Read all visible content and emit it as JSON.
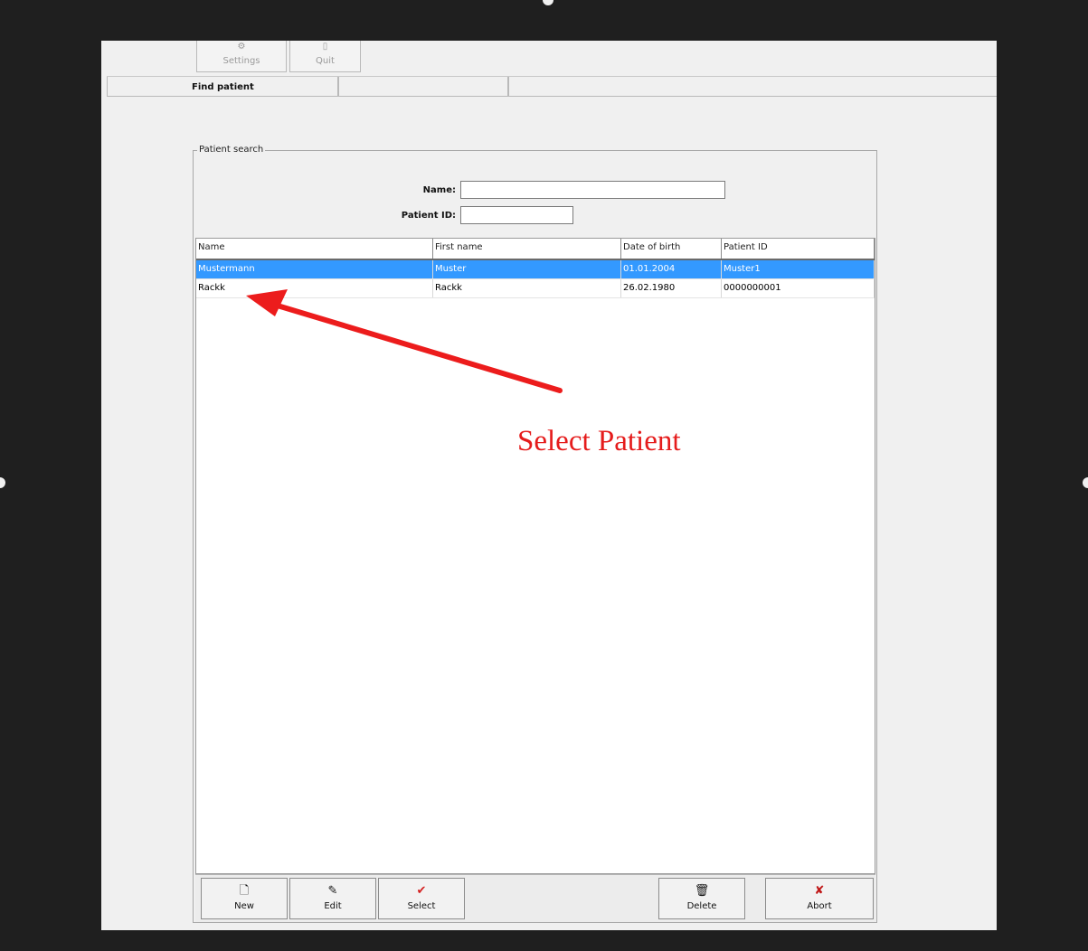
{
  "toolbar": {
    "settings_label": "Settings",
    "quit_label": "Quit"
  },
  "tabs": [
    {
      "label": "Find patient"
    },
    {
      "label": ""
    },
    {
      "label": ""
    }
  ],
  "patient_search": {
    "group_title": "Patient search",
    "name_label": "Name:",
    "name_value": "",
    "patient_id_label": "Patient ID:",
    "patient_id_value": ""
  },
  "table": {
    "columns": [
      "Name",
      "First name",
      "Date of birth",
      "Patient ID"
    ],
    "rows": [
      {
        "name": "Mustermann",
        "first_name": "Muster",
        "dob": "01.01.2004",
        "patient_id": "Muster1",
        "selected": true
      },
      {
        "name": "Rackk",
        "first_name": "Rackk",
        "dob": "26.02.1980",
        "patient_id": "0000000001",
        "selected": false
      }
    ]
  },
  "buttons": {
    "new": "New",
    "edit": "Edit",
    "select": "Select",
    "delete": "Delete",
    "abort": "Abort"
  },
  "annotation": {
    "text": "Select Patient",
    "color": "#e51c1c"
  },
  "colors": {
    "selection": "#3399ff",
    "select_check": "#d42020",
    "abort_x": "#c01818"
  },
  "icons": {
    "settings": "gear-icon",
    "quit": "door-icon",
    "new": "new-document-icon",
    "edit": "edit-icon",
    "select": "checkmark-icon",
    "delete": "trash-icon",
    "abort": "x-icon"
  }
}
